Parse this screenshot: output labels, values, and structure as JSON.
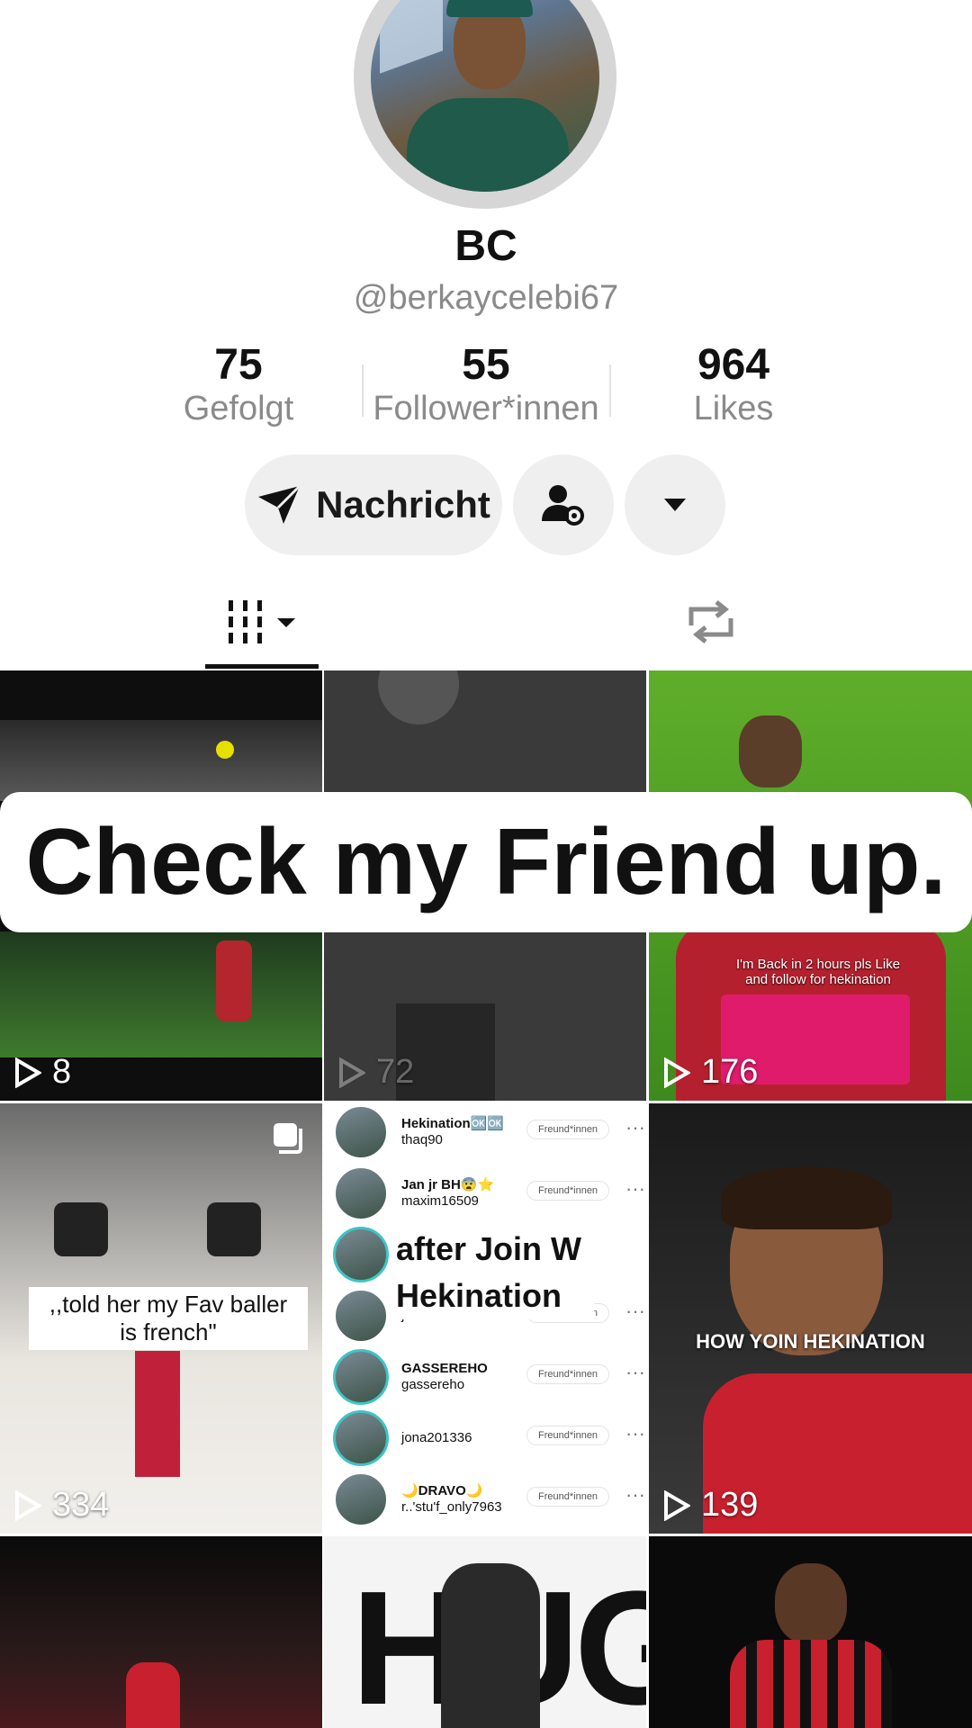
{
  "profile": {
    "display_name": "BC",
    "handle": "@berkaycelebi67"
  },
  "stats": [
    {
      "value": "75",
      "label": "Gefolgt"
    },
    {
      "value": "55",
      "label": "Follower*innen"
    },
    {
      "value": "964",
      "label": "Likes"
    }
  ],
  "actions": {
    "message_label": "Nachricht"
  },
  "tabs": {
    "videos_icon": "grid-menu-icon",
    "reposts_icon": "repost-icon"
  },
  "banner": {
    "text": "Check my Friend up."
  },
  "grid": {
    "tiles": [
      {
        "plays": "8"
      },
      {
        "plays": "72"
      },
      {
        "plays": "176",
        "overlay_text": "I'm Back in 2 hours pls Like and follow for hekination"
      },
      {
        "plays": "334",
        "caption": ",,told her my Fav baller is french\""
      },
      {
        "caption": "after Join W Hekination"
      },
      {
        "plays": "139",
        "caption": "HOW YOIN HEKINATION"
      },
      {
        "poster_text": "HUGO"
      }
    ],
    "list_rows": [
      {
        "name": "Hekination🆗🆗",
        "user": "thaq90",
        "chip": "Freund*innen"
      },
      {
        "name": "Jan jr BH😨⭐",
        "user": "maxim16509",
        "chip": "Freund*innen"
      },
      {
        "name": "",
        "user": "jxilian.578",
        "chip": "Freund*innen"
      },
      {
        "name": "GASSEREHO",
        "user": "gassereho",
        "chip": "Freund*innen"
      },
      {
        "name": "",
        "user": "jona201336",
        "chip": "Freund*innen"
      },
      {
        "name": "🌙DRAVO🌙",
        "user": "r..'stu'f_only7963",
        "chip": "Freund*innen"
      }
    ]
  },
  "colors": {
    "background": "#ffffff",
    "button_bg": "#efefef",
    "muted_text": "#8a8a8a",
    "accent_red": "#e01b3c"
  }
}
